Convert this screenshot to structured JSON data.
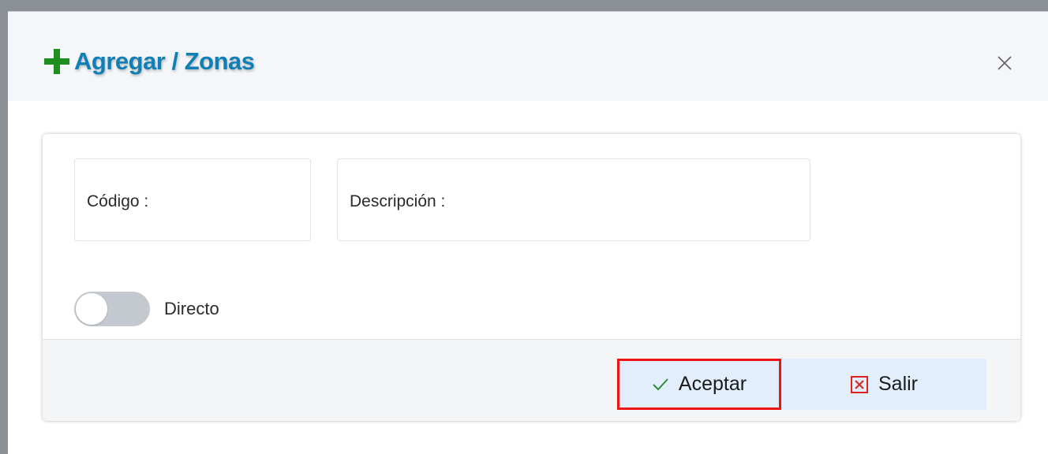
{
  "modal": {
    "title": "Agregar / Zonas",
    "close_label": "×"
  },
  "form": {
    "codigo_label": "Código :",
    "codigo_value": "",
    "descripcion_label": "Descripción :",
    "descripcion_value": ""
  },
  "toggle": {
    "label": "Directo",
    "checked": false
  },
  "footer": {
    "accept_label": "Aceptar",
    "exit_label": "Salir"
  },
  "colors": {
    "title": "#0f7fb5",
    "plus_icon": "#1e8e1e",
    "button_bg": "#e3eefc",
    "highlight_border": "#f21212",
    "exit_icon": "#e02020"
  },
  "icons": {
    "title_icon": "plus-icon",
    "close_icon": "close-icon",
    "accept_icon": "check-icon",
    "exit_icon": "close-square-icon"
  }
}
